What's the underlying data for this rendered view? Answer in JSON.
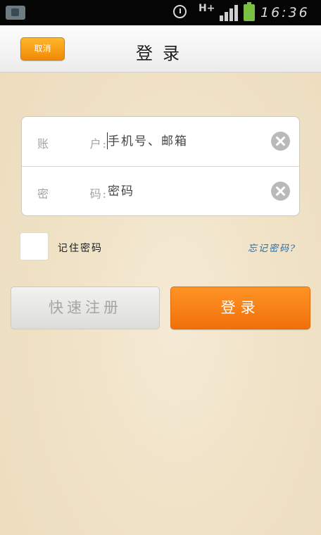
{
  "status_bar": {
    "network": "H+",
    "time": "16:36",
    "icons": [
      "notification-icon",
      "alarm-icon",
      "signal-icon",
      "battery-icon"
    ],
    "battery_color": "#7ac143"
  },
  "header": {
    "cancel_label": "取消",
    "title": "登录"
  },
  "form": {
    "account": {
      "label_left": "账",
      "label_right": "户:",
      "value": "手机号、邮箱"
    },
    "password": {
      "label_left": "密",
      "label_right": "码:",
      "value": "密码"
    },
    "clear_icon": "clear-icon"
  },
  "options": {
    "remember_label": "记住密码",
    "forgot_label": "忘记密码?"
  },
  "actions": {
    "register_label": "快速注册",
    "login_label": "登录"
  },
  "colors": {
    "accent_orange": "#f0700b",
    "link_blue": "#1f6fb0",
    "background": "#f0e2c6"
  }
}
